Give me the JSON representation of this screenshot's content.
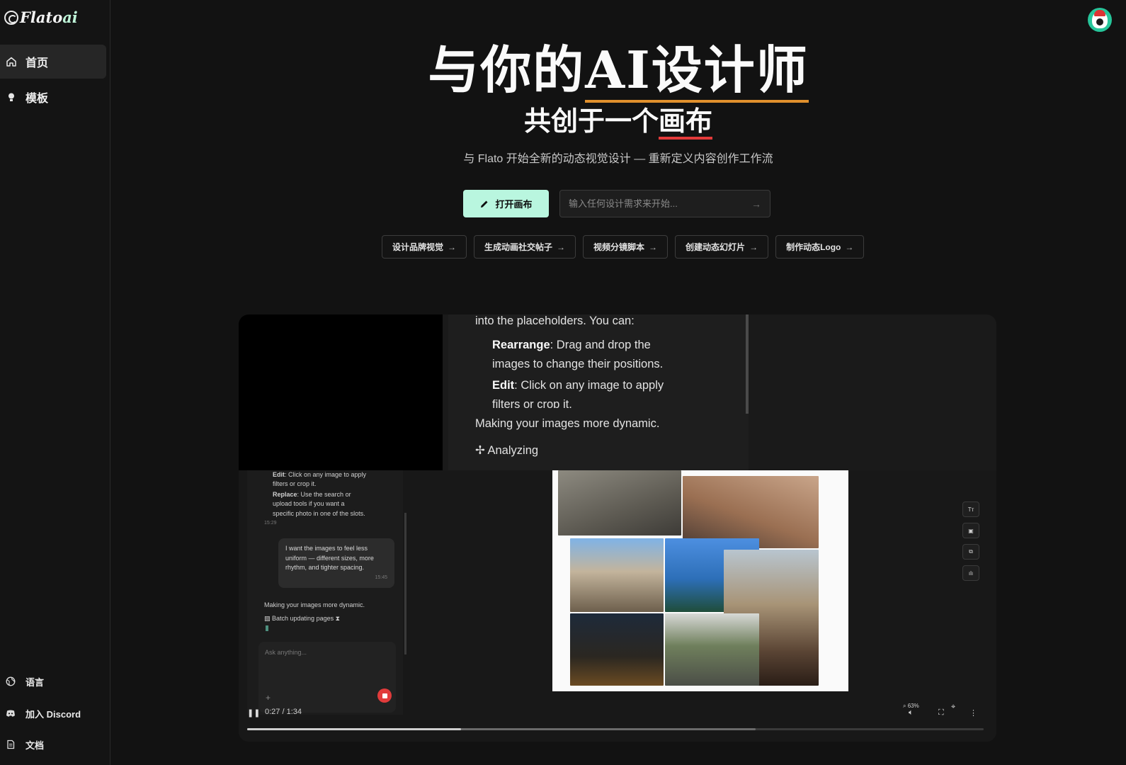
{
  "sidebar": {
    "logo": {
      "main": "Flato",
      "accent": "ai"
    },
    "nav": [
      {
        "label": "首页",
        "icon": "home-icon",
        "active": true
      },
      {
        "label": "模板",
        "icon": "bulb-icon",
        "active": false
      }
    ],
    "bottom": [
      {
        "label": "语言",
        "icon": "globe-icon"
      },
      {
        "label": "加入 Discord",
        "icon": "discord-icon"
      },
      {
        "label": "文档",
        "icon": "document-icon"
      }
    ]
  },
  "hero": {
    "title_plain": "与你的",
    "title_highlight": "AI设计师",
    "subtitle_plain": "共创于一个",
    "subtitle_highlight": "画布",
    "description": "与 Flato 开始全新的动态视觉设计 — 重新定义内容创作工作流",
    "open_button": "打开画布",
    "prompt_placeholder": "输入任何设计需求来开始...",
    "chips": [
      "设计品牌视觉",
      "生成动画社交帖子",
      "视频分镜脚本",
      "创建动态幻灯片",
      "制作动态Logo"
    ]
  },
  "video": {
    "chat_top": {
      "line1": "into the placeholders. You can:",
      "rearrange_label": "Rearrange",
      "rearrange_text1": ": Drag and drop the",
      "rearrange_text2": "images to change their positions.",
      "edit_label": "Edit",
      "edit_text1": ": Click on any image to apply",
      "edit_text2": "filters or crop it.",
      "making": "Making your images more dynamic.",
      "analyzing": "Analyzing"
    },
    "panel": {
      "edit_label": "Edit",
      "edit_l1": ": Click on any image to apply",
      "edit_l2": "filters or crop it.",
      "replace_label": "Replace",
      "replace_l1": ": Use the search or",
      "replace_l2": "upload tools if you want a",
      "replace_l3": "specific photo in one of the slots.",
      "time1": "15:29",
      "user_msg": "I want the images to feel less uniform — different sizes, more rhythm, and tighter spacing.",
      "time2": "15:45",
      "making": "Making your images more dynamic.",
      "batch": "Batch updating pages",
      "ask_placeholder": "Ask anything..."
    },
    "tools": [
      "Tт",
      "▣",
      "⧉",
      "ılı"
    ],
    "time_display": "0:27 / 1:34",
    "zoom": "63%",
    "progress": 0.29,
    "buffered": 0.69
  }
}
